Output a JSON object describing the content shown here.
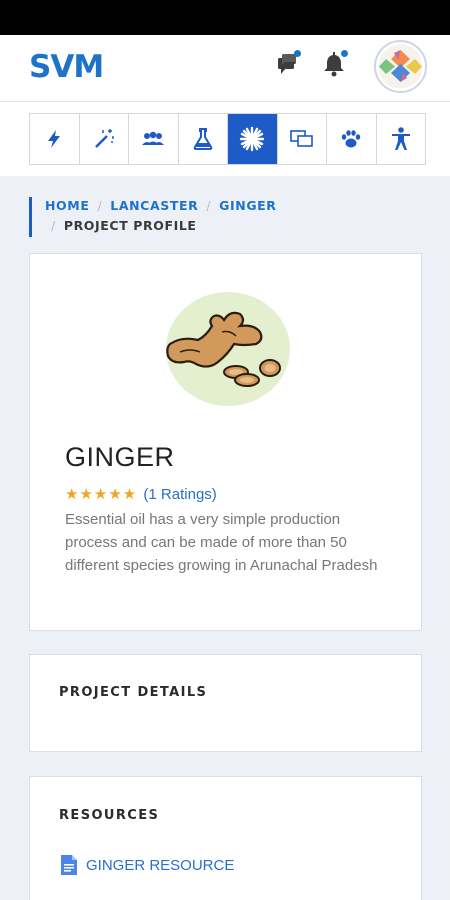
{
  "app": {
    "logo": "SVM"
  },
  "header": {
    "icons": [
      "chat-icon",
      "bell-icon",
      "avatar"
    ],
    "accent": "#1d73c9"
  },
  "menu": {
    "items": [
      {
        "icon": "lightning-icon"
      },
      {
        "icon": "magic-wand-icon"
      },
      {
        "icon": "group-icon"
      },
      {
        "icon": "flask-icon"
      },
      {
        "icon": "flower-icon",
        "active": true
      },
      {
        "icon": "chat-bubbles-icon"
      },
      {
        "icon": "paw-icon"
      },
      {
        "icon": "accessibility-icon"
      }
    ],
    "active_color": "#1e5bc6"
  },
  "breadcrumb": {
    "home": "HOME",
    "location": "LANCASTER",
    "item": "GINGER",
    "current": "PROJECT PROFILE",
    "separator": "/"
  },
  "project": {
    "title": "GINGER",
    "stars": "★★★★★",
    "rating_text": "(1 Ratings)",
    "description": "Essential oil has a very simple production process and can be made of more than 50 different species growing in Arunachal Pradesh"
  },
  "details": {
    "title": "PROJECT DETAILS"
  },
  "resources": {
    "title": "RESOURCES",
    "items": [
      {
        "label": "GINGER RESOURCE",
        "icon": "document-icon"
      }
    ]
  }
}
